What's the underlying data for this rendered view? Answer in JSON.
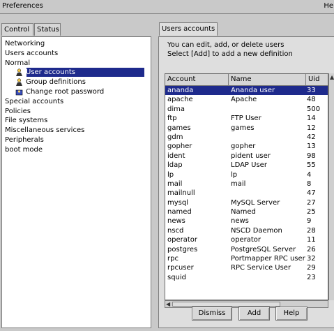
{
  "window": {
    "title": "Preferences",
    "help_short": "He"
  },
  "left_tabs": [
    "Control",
    "Status"
  ],
  "tree": [
    {
      "label": "Networking",
      "level": 0
    },
    {
      "label": "Users accounts",
      "level": 0
    },
    {
      "label": "Normal",
      "level": 0
    },
    {
      "label": "User accounts",
      "level": 1,
      "selected": true,
      "icon": "user-accounts-icon"
    },
    {
      "label": "Group definitions",
      "level": 1,
      "icon": "group-definitions-icon"
    },
    {
      "label": "Change root password",
      "level": 1,
      "icon": "change-root-password-icon"
    },
    {
      "label": "Special accounts",
      "level": 0
    },
    {
      "label": "Policies",
      "level": 0
    },
    {
      "label": "File systems",
      "level": 0
    },
    {
      "label": "Miscellaneous services",
      "level": 0
    },
    {
      "label": "Peripherals",
      "level": 0
    },
    {
      "label": "boot mode",
      "level": 0
    }
  ],
  "right_tab": "Users accounts",
  "description": {
    "line1": "You can edit, add, or delete users",
    "line2": "Select [Add] to add a new definition"
  },
  "table": {
    "columns": [
      "Account",
      "Name",
      "Uid"
    ],
    "rows": [
      [
        "ananda",
        "Ananda user",
        "33",
        true
      ],
      [
        "apache",
        "Apache",
        "48"
      ],
      [
        "dima",
        "",
        "500"
      ],
      [
        "ftp",
        "FTP User",
        "14"
      ],
      [
        "games",
        "games",
        "12"
      ],
      [
        "gdm",
        "",
        "42"
      ],
      [
        "gopher",
        "gopher",
        "13"
      ],
      [
        "ident",
        "pident user",
        "98"
      ],
      [
        "ldap",
        "LDAP User",
        "55"
      ],
      [
        "lp",
        "lp",
        "4"
      ],
      [
        "mail",
        "mail",
        "8"
      ],
      [
        "mailnull",
        "",
        "47"
      ],
      [
        "mysql",
        "MySQL Server",
        "27"
      ],
      [
        "named",
        "Named",
        "25"
      ],
      [
        "news",
        "news",
        "9"
      ],
      [
        "nscd",
        "NSCD Daemon",
        "28"
      ],
      [
        "operator",
        "operator",
        "11"
      ],
      [
        "postgres",
        "PostgreSQL Server",
        "26"
      ],
      [
        "rpc",
        "Portmapper RPC user",
        "32"
      ],
      [
        "rpcuser",
        "RPC Service User",
        "29"
      ],
      [
        "squid",
        "",
        "23"
      ]
    ]
  },
  "buttons": {
    "dismiss": "Dismiss",
    "add": "Add",
    "help": "Help"
  },
  "colors": {
    "selection": "#1e2a8c",
    "background": "#c9c9c9",
    "panel": "#dedede"
  }
}
